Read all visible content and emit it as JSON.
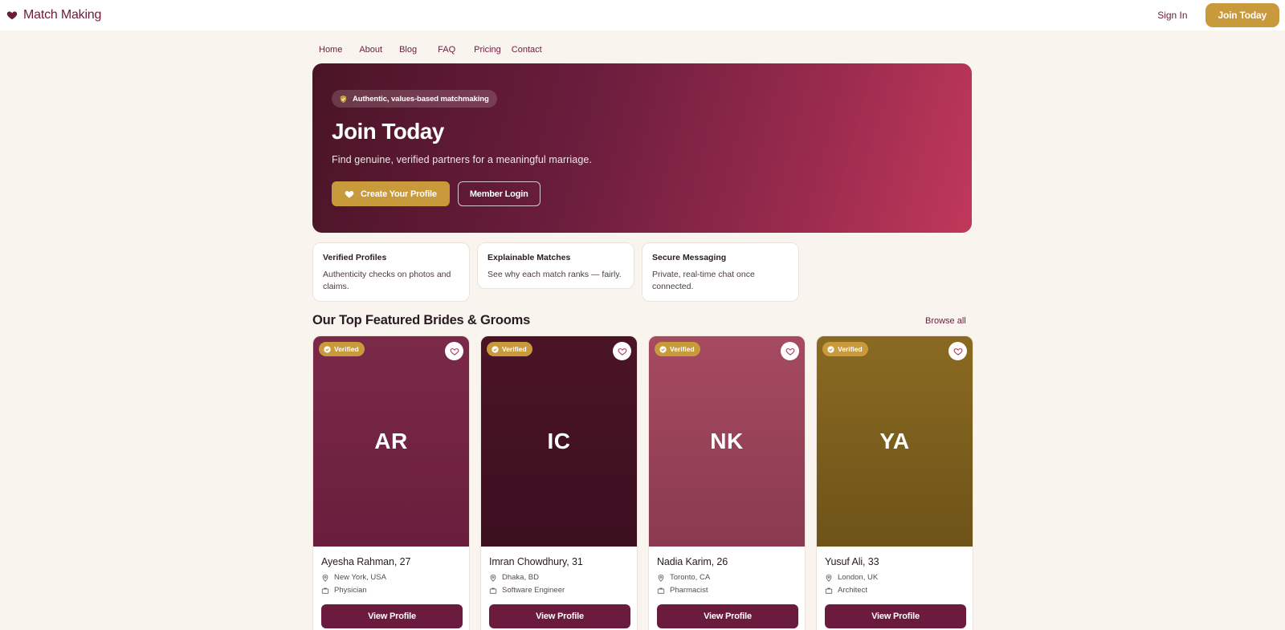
{
  "brand": {
    "name": "Match Making",
    "icon": "heart-icon",
    "color": "#6b1c3e"
  },
  "top_actions": {
    "sign_in": "Sign In",
    "join": "Join Today"
  },
  "nav": [
    "Home",
    "About",
    "Blog",
    "FAQ",
    "Pricing",
    "Contact"
  ],
  "hero": {
    "badge": "Authentic, values-based matchmaking",
    "title": "Join Today",
    "subtitle": "Find genuine, verified partners for a meaningful marriage.",
    "primary_cta": "Create Your Profile",
    "secondary_cta": "Member Login"
  },
  "features": [
    {
      "title": "Verified Profiles",
      "desc": "Authenticity checks on photos and claims."
    },
    {
      "title": "Explainable Matches",
      "desc": "See why each match ranks — fairly."
    },
    {
      "title": "Secure Messaging",
      "desc": "Private, real-time chat once connected."
    }
  ],
  "section": {
    "title": "Our Top Featured Brides & Grooms",
    "browse": "Browse all"
  },
  "profiles": [
    {
      "initials": "AR",
      "name": "Ayesha Rahman, 27",
      "location": "New York, USA",
      "job": "Physician",
      "verified": "Verified",
      "cta": "View Profile",
      "color_top": "#7a2a48",
      "color_bottom": "#6a1d3c"
    },
    {
      "initials": "IC",
      "name": "Imran Chowdhury, 31",
      "location": "Dhaka, BD",
      "job": "Software Engineer",
      "verified": "Verified",
      "cta": "View Profile",
      "color_top": "#4a1426",
      "color_bottom": "#3c0f20"
    },
    {
      "initials": "NK",
      "name": "Nadia Karim, 26",
      "location": "Toronto, CA",
      "job": "Pharmacist",
      "verified": "Verified",
      "cta": "View Profile",
      "color_top": "#a64a60",
      "color_bottom": "#8a3a50"
    },
    {
      "initials": "YA",
      "name": "Yusuf Ali, 33",
      "location": "London, UK",
      "job": "Architect",
      "verified": "Verified",
      "cta": "View Profile",
      "color_top": "#8a6a22",
      "color_bottom": "#6e5318"
    }
  ],
  "colors": {
    "accent_gold": "#c99a3b",
    "primary": "#6b1c3e",
    "background": "#faf4ee"
  }
}
